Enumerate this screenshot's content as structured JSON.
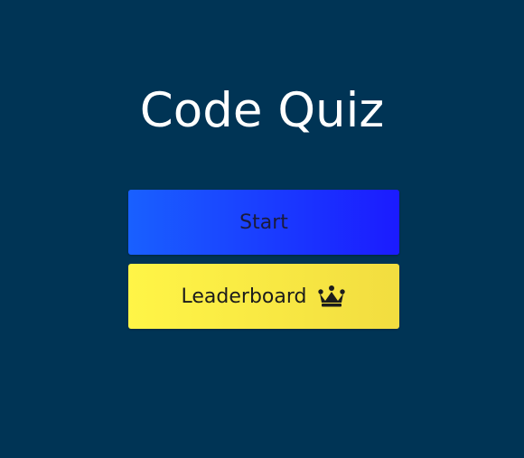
{
  "app": {
    "title": "Code Quiz"
  },
  "buttons": {
    "start_label": "Start",
    "leaderboard_label": "Leaderboard"
  },
  "icons": {
    "leaderboard_icon": "crown-icon"
  },
  "colors": {
    "background": "#003455",
    "start_button_start": "#1960ff",
    "start_button_end": "#1b1bff",
    "leaderboard_button_start": "#fff547",
    "leaderboard_button_end": "#f2dd40",
    "title_text": "#ffffff"
  }
}
